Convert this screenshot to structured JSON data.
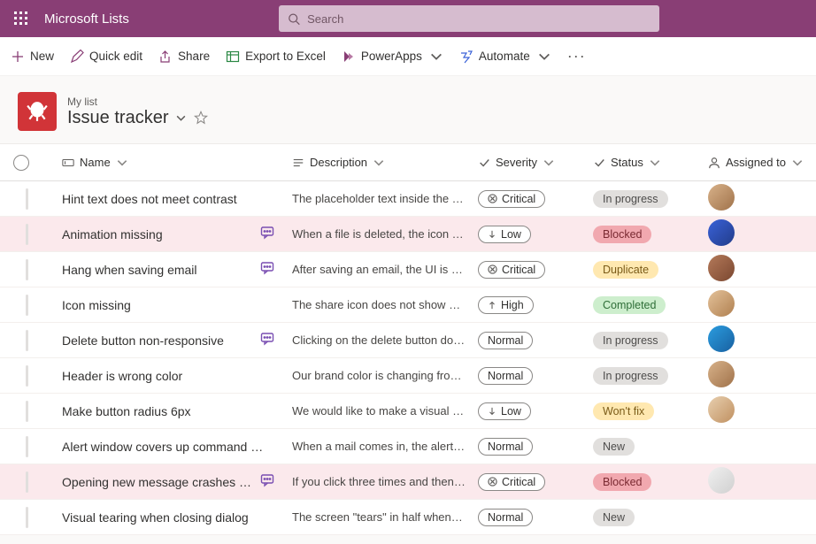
{
  "header": {
    "app_name": "Microsoft Lists",
    "search_placeholder": "Search"
  },
  "commands": {
    "new": "New",
    "quick_edit": "Quick edit",
    "share": "Share",
    "export": "Export to Excel",
    "powerapps": "PowerApps",
    "automate": "Automate"
  },
  "list": {
    "breadcrumb": "My list",
    "title": "Issue tracker"
  },
  "columns": {
    "name": "Name",
    "description": "Description",
    "severity": "Severity",
    "status": "Status",
    "assigned_to": "Assigned to"
  },
  "severity_labels": {
    "critical": "Critical",
    "low": "Low",
    "high": "High",
    "normal": "Normal"
  },
  "status_labels": {
    "inprogress": "In progress",
    "blocked": "Blocked",
    "duplicate": "Duplicate",
    "completed": "Completed",
    "wontfix": "Won't fix",
    "new": "New"
  },
  "rows": [
    {
      "name": "Hint text does not meet contrast",
      "comment": false,
      "desc": "The placeholder text inside the textfi…",
      "severity": "critical",
      "status": "inprogress",
      "avatar": "a1"
    },
    {
      "name": "Animation missing",
      "comment": true,
      "desc": "When a file is deleted, the icon shoul…",
      "severity": "low",
      "status": "blocked",
      "avatar": "a2"
    },
    {
      "name": "Hang when saving email",
      "comment": true,
      "desc": "After saving an email, the UI is non-r…",
      "severity": "critical",
      "status": "duplicate",
      "avatar": "a3"
    },
    {
      "name": "Icon missing",
      "comment": false,
      "desc": "The share icon does not show up in t…",
      "severity": "high",
      "status": "completed",
      "avatar": "a4"
    },
    {
      "name": "Delete button non-responsive",
      "comment": true,
      "desc": "Clicking on the delete button does n…",
      "severity": "normal",
      "status": "inprogress",
      "avatar": "a5"
    },
    {
      "name": "Header is wrong color",
      "comment": false,
      "desc": "Our brand color is changing from gr…",
      "severity": "normal",
      "status": "inprogress",
      "avatar": "a1"
    },
    {
      "name": "Make button radius 6px",
      "comment": false,
      "desc": "We would like to make a visual chan…",
      "severity": "low",
      "status": "wontfix",
      "avatar": "a6"
    },
    {
      "name": "Alert window covers up command …",
      "comment": false,
      "desc": "When a mail comes in, the alert toast…",
      "severity": "normal",
      "status": "new",
      "avatar": ""
    },
    {
      "name": "Opening new message crashes syst…",
      "comment": true,
      "desc": "If you click three times and then ope…",
      "severity": "critical",
      "status": "blocked",
      "avatar": "a7"
    },
    {
      "name": "Visual tearing when closing dialog",
      "comment": false,
      "desc": "The screen \"tears\" in half when you c…",
      "severity": "normal",
      "status": "new",
      "avatar": ""
    }
  ]
}
